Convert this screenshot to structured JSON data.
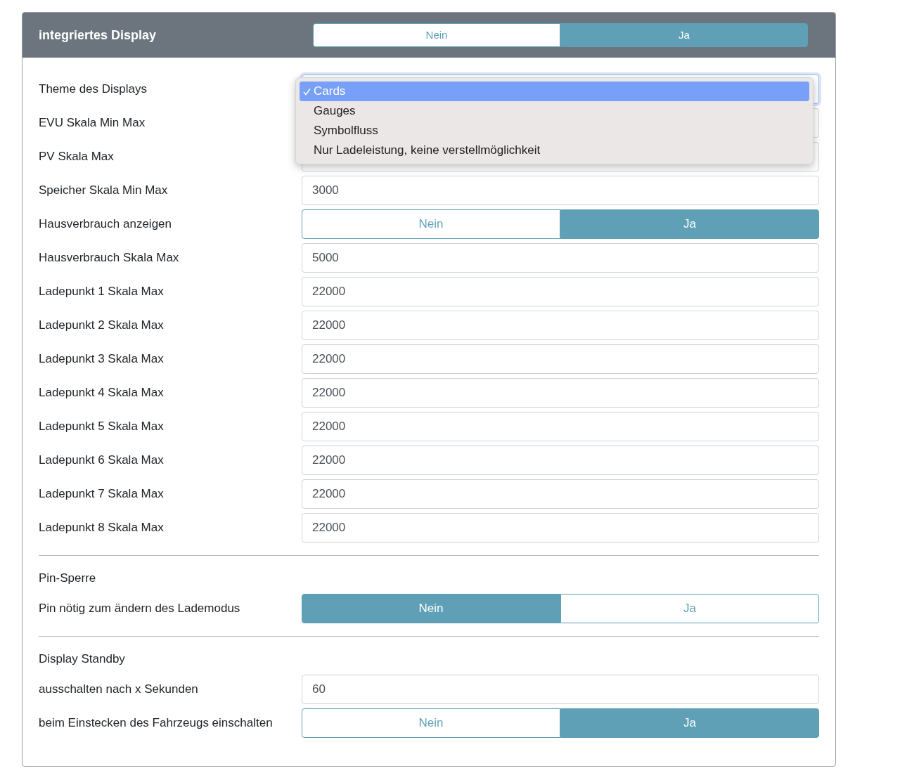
{
  "header": {
    "title": "integriertes Display",
    "options": [
      {
        "label": "Nein",
        "selected": false
      },
      {
        "label": "Ja",
        "selected": true
      }
    ]
  },
  "sections": [
    {
      "rows": [
        {
          "kind": "select",
          "label": "Theme des Displays",
          "open": true,
          "options": [
            {
              "label": "Cards",
              "selected": true
            },
            {
              "label": "Gauges",
              "selected": false
            },
            {
              "label": "Symbolfluss",
              "selected": false
            },
            {
              "label": "Nur Ladeleistung, keine verstellmöglichkeit",
              "selected": false
            }
          ]
        },
        {
          "kind": "input",
          "label": "EVU Skala Min Max"
        },
        {
          "kind": "input",
          "label": "PV Skala Max"
        },
        {
          "kind": "input",
          "label": "Speicher Skala Min Max",
          "value": "3000"
        },
        {
          "kind": "toggle",
          "label": "Hausverbrauch anzeigen",
          "options": [
            {
              "label": "Nein",
              "selected": false
            },
            {
              "label": "Ja",
              "selected": true
            }
          ]
        },
        {
          "kind": "input",
          "label": "Hausverbrauch Skala Max",
          "value": "5000"
        },
        {
          "kind": "input",
          "label": "Ladepunkt 1 Skala Max",
          "value": "22000"
        },
        {
          "kind": "input",
          "label": "Ladepunkt 2 Skala Max",
          "value": "22000"
        },
        {
          "kind": "input",
          "label": "Ladepunkt 3 Skala Max",
          "value": "22000"
        },
        {
          "kind": "input",
          "label": "Ladepunkt 4 Skala Max",
          "value": "22000"
        },
        {
          "kind": "input",
          "label": "Ladepunkt 5 Skala Max",
          "value": "22000"
        },
        {
          "kind": "input",
          "label": "Ladepunkt 6 Skala Max",
          "value": "22000"
        },
        {
          "kind": "input",
          "label": "Ladepunkt 7 Skala Max",
          "value": "22000"
        },
        {
          "kind": "input",
          "label": "Ladepunkt 8 Skala Max",
          "value": "22000"
        }
      ]
    },
    {
      "heading": "Pin-Sperre",
      "rows": [
        {
          "kind": "toggle",
          "label": "Pin nötig zum ändern des Lademodus",
          "options": [
            {
              "label": "Nein",
              "selected": true
            },
            {
              "label": "Ja",
              "selected": false
            }
          ]
        }
      ]
    },
    {
      "heading": "Display Standby",
      "rows": [
        {
          "kind": "input",
          "label": "ausschalten nach x Sekunden",
          "value": "60"
        },
        {
          "kind": "toggle",
          "label": "beim Einstecken des Fahrzeugs einschalten",
          "options": [
            {
              "label": "Nein",
              "selected": false
            },
            {
              "label": "Ja",
              "selected": true
            }
          ]
        }
      ]
    }
  ]
}
